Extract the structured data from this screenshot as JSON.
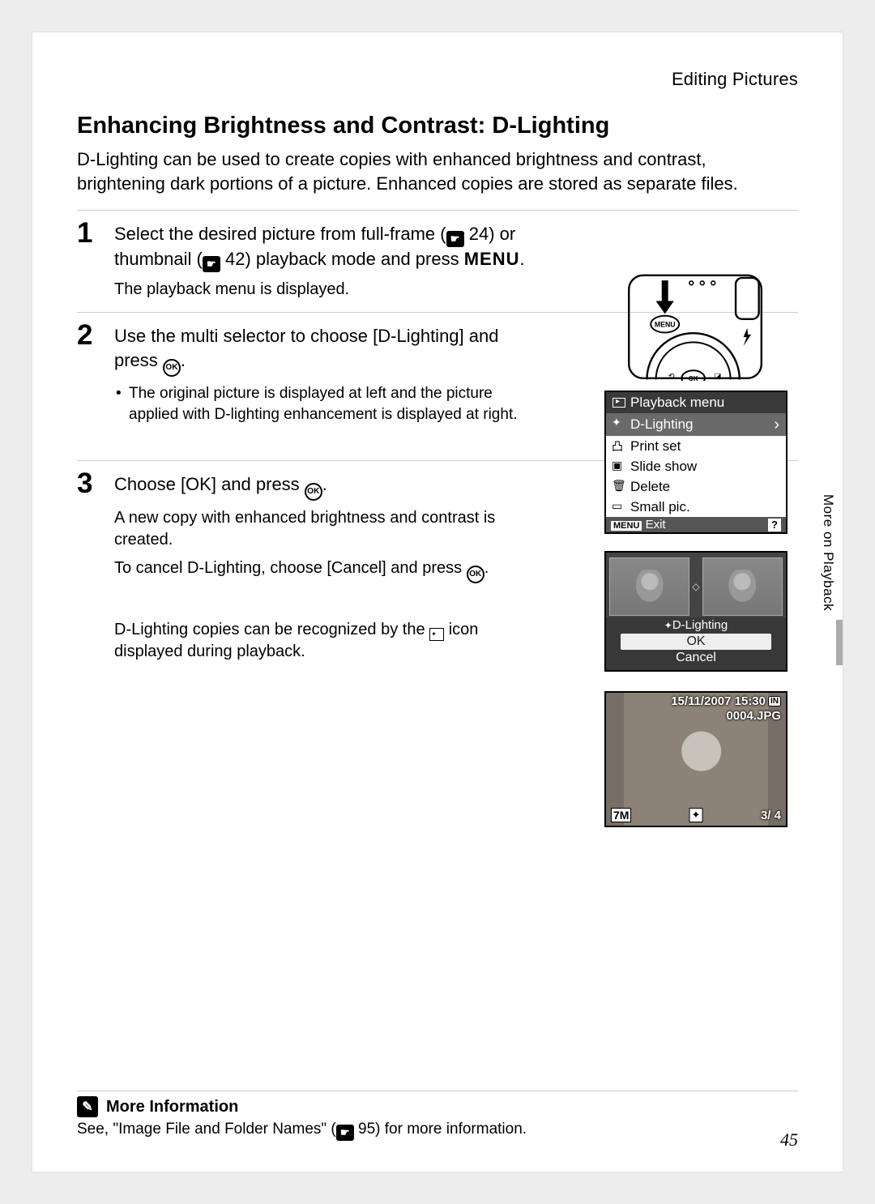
{
  "header_section": "Editing Pictures",
  "title": "Enhancing Brightness and Contrast: D-Lighting",
  "intro": "D-Lighting can be used to create copies with enhanced brightness and contrast, brightening dark portions of a picture. Enhanced copies are stored as separate files.",
  "step1": {
    "num": "1",
    "head_a": "Select the desired picture from full-frame (",
    "ref1": "24",
    "head_b": ") or thumbnail (",
    "ref2": "42",
    "head_c": ") playback mode and press ",
    "menu_word": "MENU",
    "head_d": ".",
    "desc": "The playback menu is displayed."
  },
  "step2": {
    "num": "2",
    "head_a": "Use the multi selector to choose [D-Lighting] and press ",
    "bullet": "The original picture is displayed at left and the picture applied with D-lighting enhancement is displayed at right."
  },
  "step3": {
    "num": "3",
    "head_a": "Choose [OK] and press ",
    "desc1": "A new copy with enhanced brightness and contrast is created.",
    "desc2a": "To cancel D-Lighting, choose [Cancel] and press ",
    "desc3a": "D-Lighting copies can be recognized by the ",
    "desc3b": " icon displayed during playback."
  },
  "menu_screen": {
    "title": "Playback menu",
    "items": [
      {
        "icon": "✦",
        "label": "D-Lighting",
        "sel": true
      },
      {
        "icon": "凸",
        "label": "Print set",
        "sel": false
      },
      {
        "icon": "▣",
        "label": "Slide show",
        "sel": false
      },
      {
        "icon": "🗑",
        "label": "Delete",
        "sel": false
      },
      {
        "icon": "▭",
        "label": "Small pic.",
        "sel": false
      }
    ],
    "exit_tag": "MENU",
    "exit_label": "Exit",
    "help": "?"
  },
  "preview": {
    "label": "D-Lighting",
    "ok": "OK",
    "cancel": "Cancel"
  },
  "play": {
    "date": "15/11/2007 15:30",
    "file": "0004.JPG",
    "mode": "7M",
    "counter": "3/    4",
    "in": "IN"
  },
  "side_tab": "More on Playback",
  "more_info": {
    "title": "More Information",
    "body_a": "See, \"Image File and Folder Names\" (",
    "body_ref": "95",
    "body_b": ") for more information."
  },
  "page_num": "45"
}
